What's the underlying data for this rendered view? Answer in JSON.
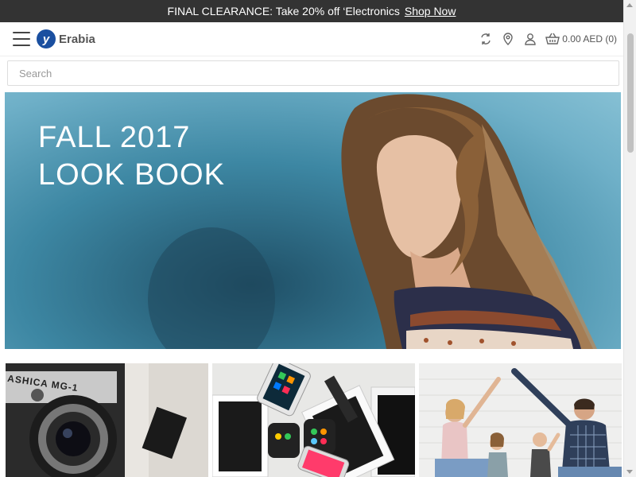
{
  "promo": {
    "text": "FINAL CLEARANCE: Take 20% off ‘Electronics",
    "link": "Shop Now"
  },
  "header": {
    "logo_mark": "y",
    "logo_text": "Erabia",
    "cart_text": "0.00 AED (0)",
    "icons": [
      "menu-icon",
      "refresh-icon",
      "location-pin-icon",
      "user-icon",
      "basket-icon"
    ]
  },
  "search": {
    "placeholder": "Search"
  },
  "hero": {
    "line1": "FALL 2017",
    "line2": "LOOK BOOK"
  },
  "tiles": [
    {
      "name": "camera",
      "camera_label": "ASHICA MG-1"
    },
    {
      "name": "devices"
    },
    {
      "name": "family"
    }
  ]
}
